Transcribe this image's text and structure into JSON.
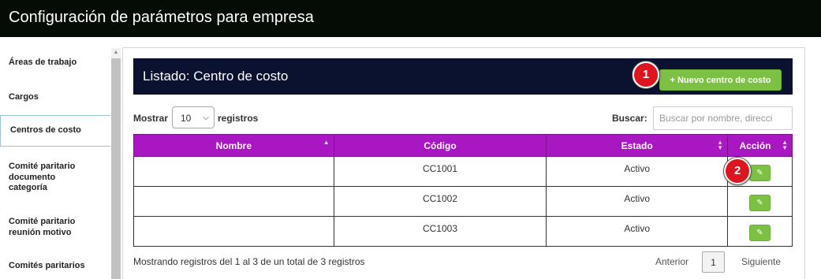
{
  "header": {
    "title": "Configuración de parámetros para empresa"
  },
  "sidebar": {
    "items": [
      {
        "label": "Áreas de trabajo"
      },
      {
        "label": "Cargos"
      },
      {
        "label": "Centros de costo"
      },
      {
        "label": "Comité paritario documento categoría"
      },
      {
        "label": "Comité paritario reunión motivo"
      },
      {
        "label": "Comités paritarios"
      }
    ]
  },
  "panel": {
    "title": "Listado: Centro de costo",
    "new_button_icon": "+",
    "new_button_label": "Nuevo centro de costo",
    "badges": [
      "1",
      "2"
    ]
  },
  "controls": {
    "show_label": "Mostrar",
    "show_value": "10",
    "records_label": "registros",
    "search_label": "Buscar:",
    "search_placeholder": "Buscar por nombre, direcci"
  },
  "table": {
    "columns": [
      "Nombre",
      "Código",
      "Estado",
      "Acción"
    ],
    "rows": [
      {
        "nombre": "",
        "codigo": "CC1001",
        "estado": "Activo"
      },
      {
        "nombre": "",
        "codigo": "CC1002",
        "estado": "Activo"
      },
      {
        "nombre": "",
        "codigo": "CC1003",
        "estado": "Activo"
      }
    ],
    "edit_icon": "pencil-icon"
  },
  "footer": {
    "info": "Mostrando registros del 1 al 3 de un total de 3 registros",
    "prev_label": "Anterior",
    "page": "1",
    "next_label": "Siguiente"
  },
  "colors": {
    "topbar": "#050c05",
    "panel_header": "#0b1230",
    "table_header": "#a817c2",
    "accent_green": "#7cc144",
    "badge_red": "#e0141e"
  }
}
